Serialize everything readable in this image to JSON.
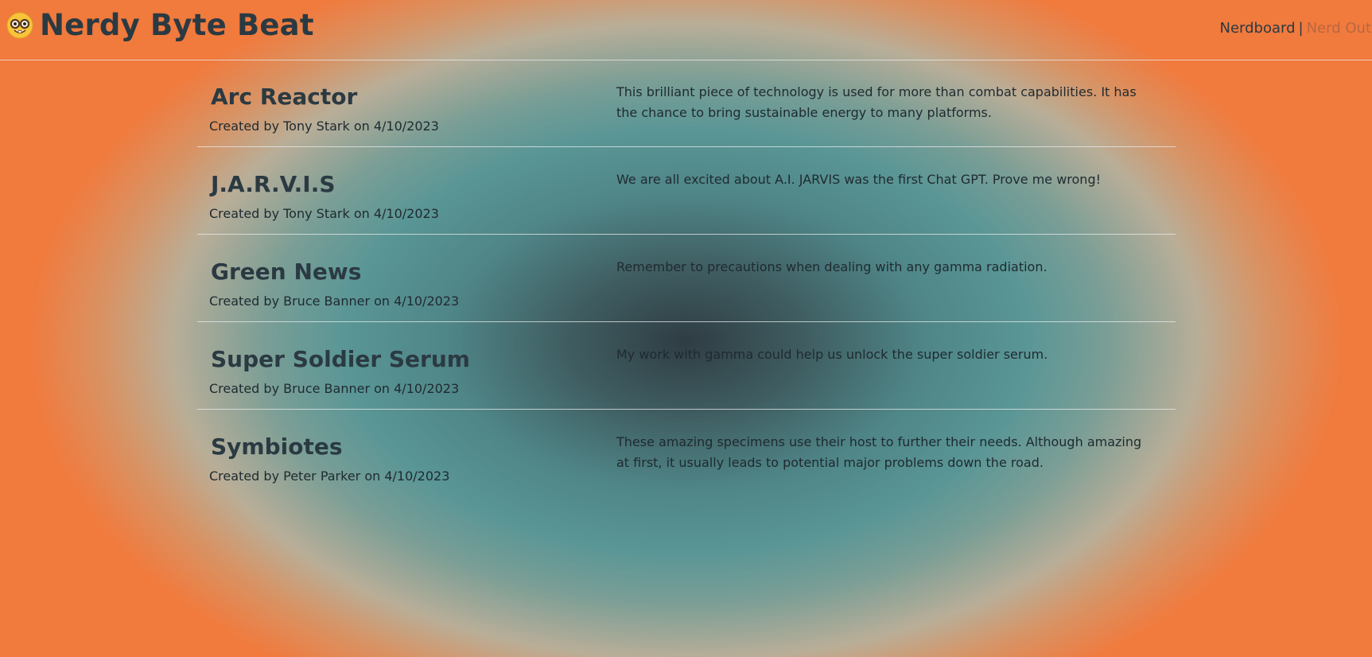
{
  "header": {
    "title": "Nerdy Byte Beat",
    "logo_icon": "nerd-face-emoji",
    "nav": {
      "nerdboard": "Nerdboard",
      "separator": "|",
      "nerd_out": "Nerd Out"
    }
  },
  "colors": {
    "text_dark": "#2b3a42",
    "accent_link": "#b9673f",
    "bg_edge": "#f17a3d",
    "bg_center": "#2f3d43",
    "bg_teal": "#5a9696"
  },
  "posts": [
    {
      "title": "Arc Reactor",
      "meta": "Created by Tony Stark on 4/10/2023",
      "body": "This brilliant piece of technology is used for more than combat capabilities. It has the chance to bring sustainable energy to many platforms."
    },
    {
      "title": "J.A.R.V.I.S",
      "meta": "Created by Tony Stark on 4/10/2023",
      "body": "We are all excited about A.I. JARVIS was the first Chat GPT. Prove me wrong!"
    },
    {
      "title": "Green News",
      "meta": "Created by Bruce Banner on 4/10/2023",
      "body": "Remember to precautions when dealing with any gamma radiation."
    },
    {
      "title": "Super Soldier Serum",
      "meta": "Created by Bruce Banner on 4/10/2023",
      "body": "My work with gamma could help us unlock the super soldier serum."
    },
    {
      "title": "Symbiotes",
      "meta": "Created by Peter Parker on 4/10/2023",
      "body": "These amazing specimens use their host to further their needs. Although amazing at first, it usually leads to potential major problems down the road."
    }
  ]
}
